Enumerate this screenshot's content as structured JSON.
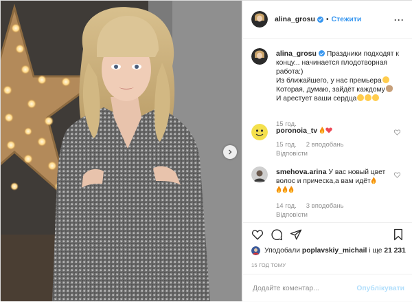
{
  "post": {
    "author": {
      "username": "alina_grosu",
      "follow_label": "Стежити"
    },
    "caption_lines": [
      "Праздники подходят к",
      "концу... начинается плодотворная",
      "работа:)",
      "Из ближайшего, у нас премьера",
      "Которая, думаю, зайдёт каждому",
      "И арестует ваши сердца"
    ],
    "caption_time": "15 год.",
    "comments": [
      {
        "username": "poronoia_tv",
        "time": "15 год.",
        "likes": "2 вподобань",
        "reply": "Відповісти"
      },
      {
        "username": "smehova.arina",
        "text_lines": [
          "У вас новый цвет",
          "волос и прическа,а вам идёт"
        ],
        "time": "14 год.",
        "likes": "3 вподобань",
        "reply": "Відповісти"
      }
    ],
    "likes_prefix": "Уподобали",
    "likes_user": "poplavskiy_michail",
    "likes_and": "і ще",
    "likes_count": "21 231",
    "time_ago": "15 ГОД ТОМУ",
    "add_comment_placeholder": "Додайте коментар...",
    "publish_label": "Опублікувати"
  },
  "colors": {
    "accent": "#3897f0",
    "publish_disabled": "#b2dffc",
    "muted": "#8e8e8e",
    "heart_red": "#ed4956"
  },
  "icons": [
    "heart-icon",
    "comment-icon",
    "share-icon",
    "bookmark-icon",
    "more-options-icon",
    "next-photo-icon",
    "verified-icon"
  ]
}
